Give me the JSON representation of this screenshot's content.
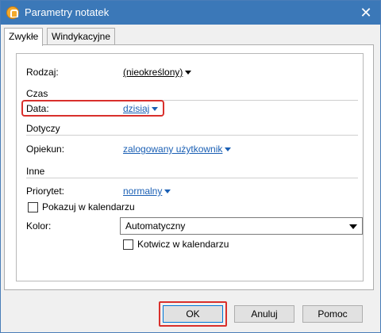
{
  "window": {
    "title": "Parametry notatek",
    "close_label": "✕"
  },
  "tabs": [
    {
      "label": "Zwykłe"
    },
    {
      "label": "Windykacyjne"
    }
  ],
  "form": {
    "rodzaj": {
      "label": "Rodzaj:",
      "value": "(nieokreślony)"
    },
    "czas": {
      "section": "Czas"
    },
    "data": {
      "label": "Data:",
      "value": "dzisiaj"
    },
    "dotyczy": {
      "section": "Dotyczy"
    },
    "opiekun": {
      "label": "Opiekun:",
      "value": "zalogowany użytkownik"
    },
    "inne": {
      "section": "Inne"
    },
    "priorytet": {
      "label": "Priorytet:",
      "value": "normalny"
    },
    "pokazuj": {
      "label": "Pokazuj w kalendarzu",
      "checked": false
    },
    "kolor": {
      "label": "Kolor:",
      "value": "Automatyczny"
    },
    "kotwicz": {
      "label": "Kotwicz w kalendarzu",
      "checked": false
    }
  },
  "buttons": {
    "ok": "OK",
    "cancel": "Anuluj",
    "help": "Pomoc"
  },
  "colors": {
    "titlebar": "#3b78b8",
    "link": "#1a5fb4",
    "highlight": "#d9302c"
  }
}
